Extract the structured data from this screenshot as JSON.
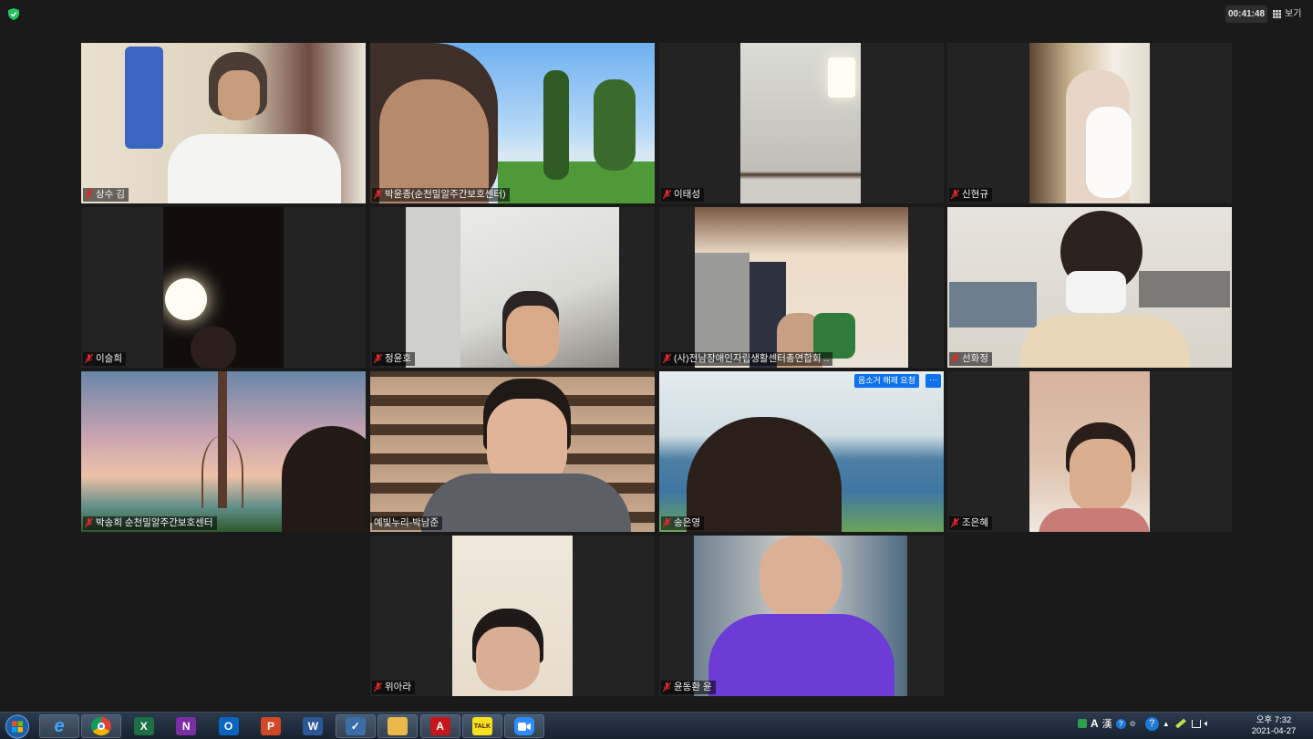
{
  "topbar": {
    "timer": "00:41:48",
    "view_label": "보기"
  },
  "participants": [
    {
      "name": "상수 김"
    },
    {
      "name": "박윤종(순천밀알주간보호센터)"
    },
    {
      "name": "이태성"
    },
    {
      "name": "신현규"
    },
    {
      "name": "이슬희"
    },
    {
      "name": "정윤호"
    },
    {
      "name": "(사)전남장애인자립생활센터총연합회 .."
    },
    {
      "name": "선화정"
    },
    {
      "name": "박송희 순천밀알주간보호센터"
    },
    {
      "name": "예빛누리-박남준"
    },
    {
      "name": "송은영"
    },
    {
      "name": "조은혜"
    },
    {
      "name": "위아라"
    },
    {
      "name": "윤동환 윤"
    }
  ],
  "unmute_request_label": "음소거 해제 요청",
  "more_label": "···",
  "taskbar": {
    "apps": [
      {
        "icon": "internet-explorer-icon",
        "label": "e",
        "color": "#1e90ff"
      },
      {
        "icon": "chrome-icon",
        "label": "",
        "color": "#db4437"
      },
      {
        "icon": "excel-icon",
        "label": "X",
        "color": "#1d7044"
      },
      {
        "icon": "onenote-icon",
        "label": "N",
        "color": "#7b2fa4"
      },
      {
        "icon": "outlook-icon",
        "label": "O",
        "color": "#0a64c0"
      },
      {
        "icon": "powerpoint-icon",
        "label": "P",
        "color": "#d24726"
      },
      {
        "icon": "word-icon",
        "label": "W",
        "color": "#2b5797"
      },
      {
        "icon": "checklist-icon",
        "label": "✓",
        "color": "#3b6ea8"
      },
      {
        "icon": "folder-icon",
        "label": "",
        "color": "#e9b949"
      },
      {
        "icon": "acrobat-icon",
        "label": "A",
        "color": "#c4161c"
      },
      {
        "icon": "kakaotalk-icon",
        "label": "TALK",
        "color": "#f7e01c"
      },
      {
        "icon": "zoom-icon",
        "label": "",
        "color": "#2d8cff"
      }
    ],
    "tray": {
      "ime_label": "A",
      "hanja_label": "漢"
    },
    "clock": {
      "time": "오후 7:32",
      "date": "2021-04-27"
    }
  }
}
